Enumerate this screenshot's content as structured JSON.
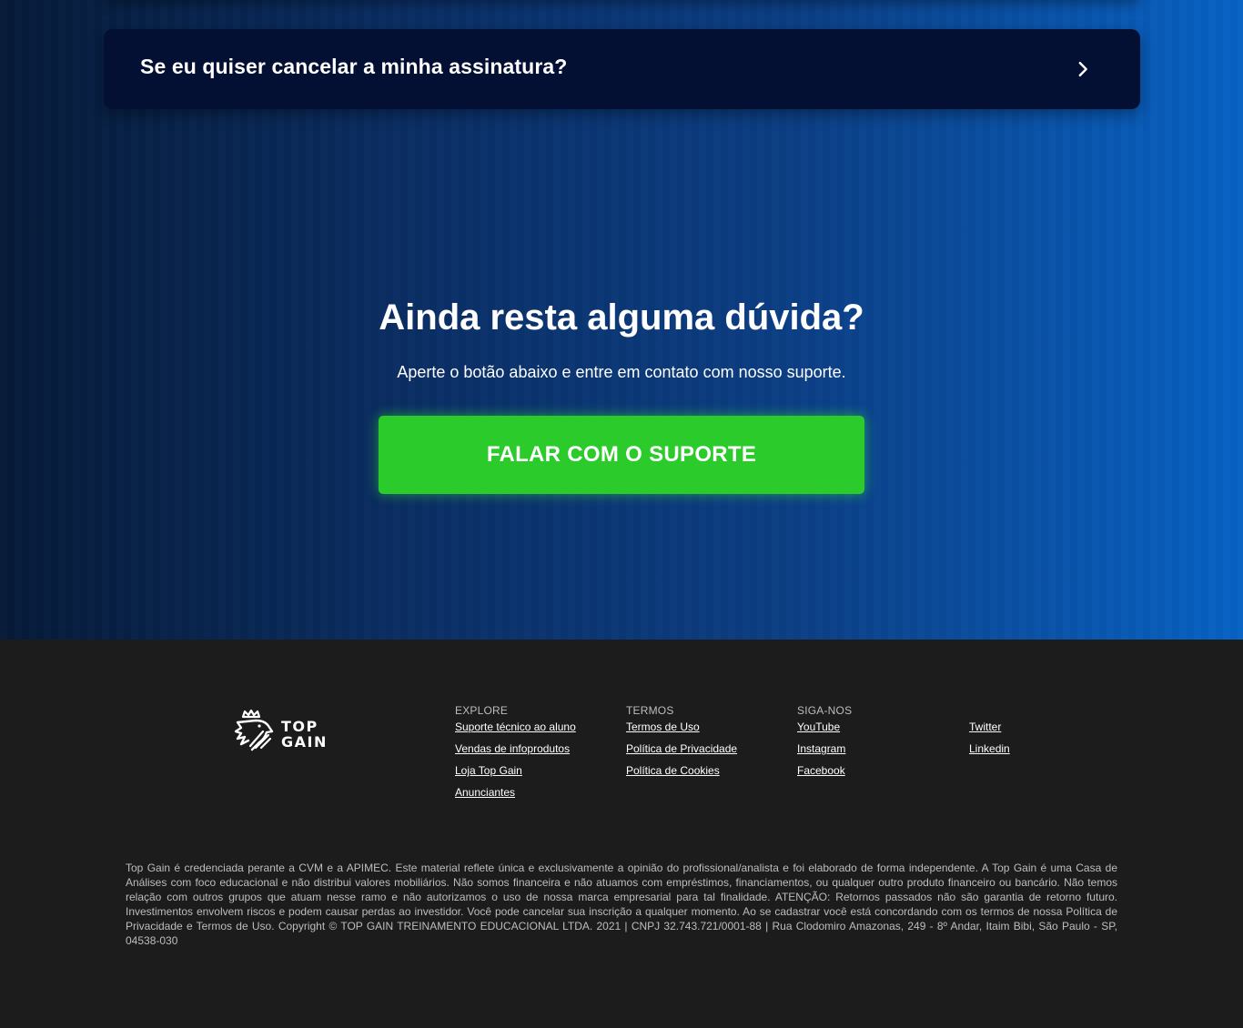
{
  "faq": {
    "question": "Se eu quiser cancelar a minha assinatura?",
    "chevron_icon": "chevron-right-icon"
  },
  "cta": {
    "title": "Ainda resta alguma dúvida?",
    "subtitle": "Aperte o botão abaixo e entre em contato com nosso suporte.",
    "button_label": "FALAR COM O SUPORTE",
    "button_color": "#2bcb2b"
  },
  "footer": {
    "logo": {
      "line1": "TOP",
      "line2": "GAIN",
      "icon": "lion-crown-logo-icon"
    },
    "explore": {
      "title": "EXPLORE",
      "links": [
        "Suporte técnico ao aluno",
        "Vendas de infoprodutos",
        "Loja Top Gain",
        "Anunciantes"
      ]
    },
    "termos": {
      "title": "TERMOS",
      "links": [
        "Termos de Uso",
        "Política de Privacidade",
        "Política de Cookies"
      ]
    },
    "siga": {
      "title": "SIGA-NOS",
      "links": [
        "YouTube",
        "Instagram",
        "Facebook"
      ]
    },
    "siga_extra": {
      "links": [
        "Twitter",
        "Linkedin"
      ]
    },
    "disclaimer": "Top Gain é credenciada perante a CVM e a APIMEC. Este material reflete única e exclusivamente a opinião do profissional/analista e foi elaborado de forma independente. A Top Gain é uma Casa de Análises com foco educacional e não distribui valores mobiliários. Não somos financeira e não atuamos com empréstimos, financiamentos, ou qualquer outro produto financeiro ou bancário. Não temos relação com outros grupos que atuam nesse ramo e não autorizamos o uso de nossa marca empresarial para tal finalidade. ATENÇÃO: Retornos passados não são garantia de retorno futuro. Investimentos envolvem riscos e podem causar perdas ao investidor. Você pode cancelar sua inscrição a qualquer momento. Ao se cadastrar você está concordando com os termos de nossa Política de Privacidade e Termos de Uso. Copyright © TOP GAIN TREINAMENTO EDUCACIONAL LTDA. 2021 | CNPJ 32.743.721/0001-88 | Rua Clodomiro Amazonas, 249 - 8º Andar, Itaim Bibi, São Paulo - SP, 04538-030"
  }
}
